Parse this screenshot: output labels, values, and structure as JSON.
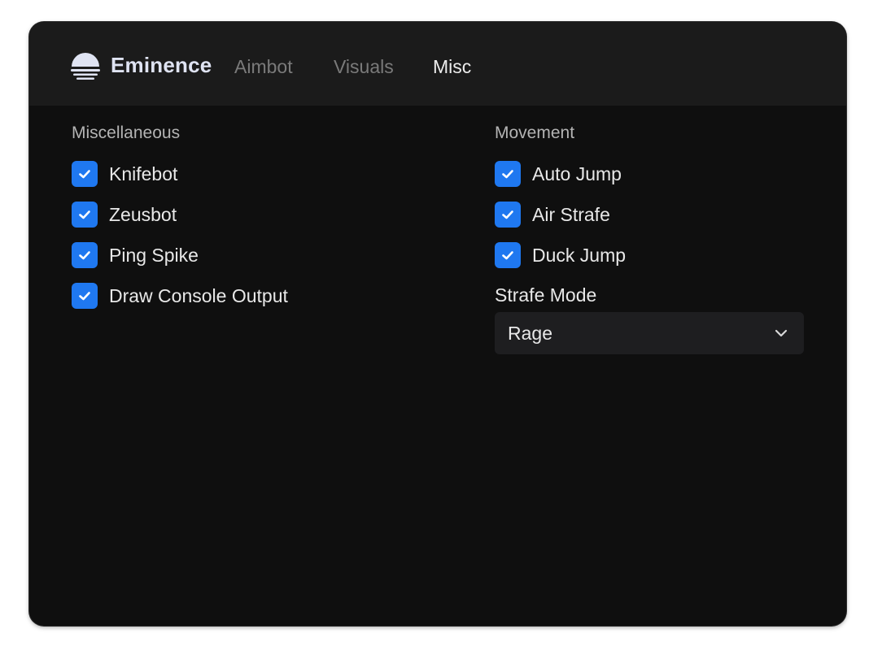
{
  "app": {
    "brand": "Eminence",
    "icon": "sunset-icon",
    "accent_color": "#1f78f0"
  },
  "tabs": [
    {
      "label": "Aimbot",
      "active": false
    },
    {
      "label": "Visuals",
      "active": false
    },
    {
      "label": "Misc",
      "active": true
    }
  ],
  "miscellaneous": {
    "title": "Miscellaneous",
    "items": [
      {
        "label": "Knifebot",
        "checked": true
      },
      {
        "label": "Zeusbot",
        "checked": true
      },
      {
        "label": "Ping Spike",
        "checked": true
      },
      {
        "label": "Draw Console Output",
        "checked": true
      }
    ]
  },
  "movement": {
    "title": "Movement",
    "items": [
      {
        "label": "Auto Jump",
        "checked": true
      },
      {
        "label": "Air Strafe",
        "checked": true
      },
      {
        "label": "Duck Jump",
        "checked": true
      }
    ],
    "strafe_mode": {
      "label": "Strafe Mode",
      "value": "Rage",
      "icon": "chevron-down-icon"
    }
  }
}
